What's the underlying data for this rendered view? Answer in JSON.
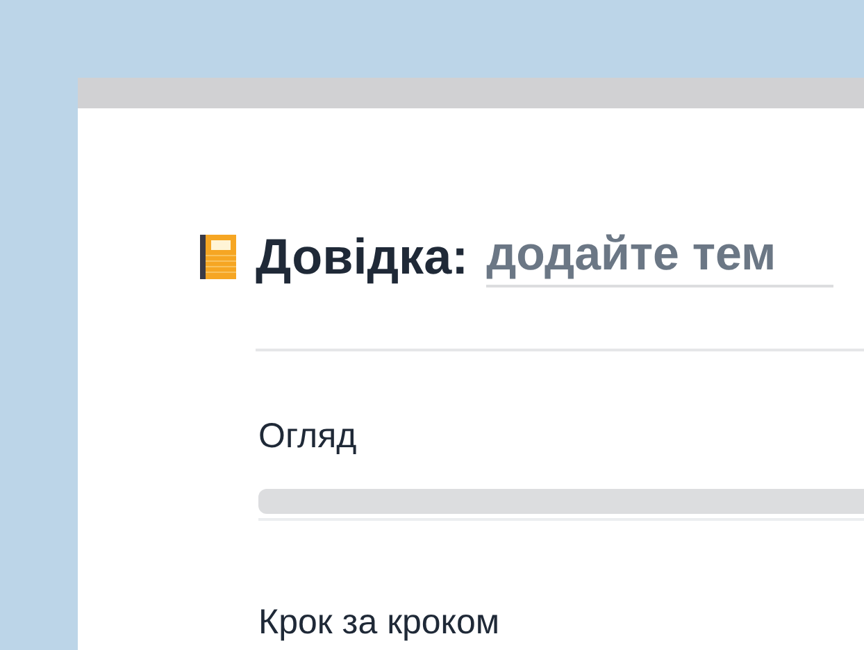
{
  "title": {
    "label": "Довідка:",
    "placeholder": "додайте тем"
  },
  "sections": [
    {
      "heading": "Огляд"
    },
    {
      "heading": "Крок за кроком"
    }
  ]
}
